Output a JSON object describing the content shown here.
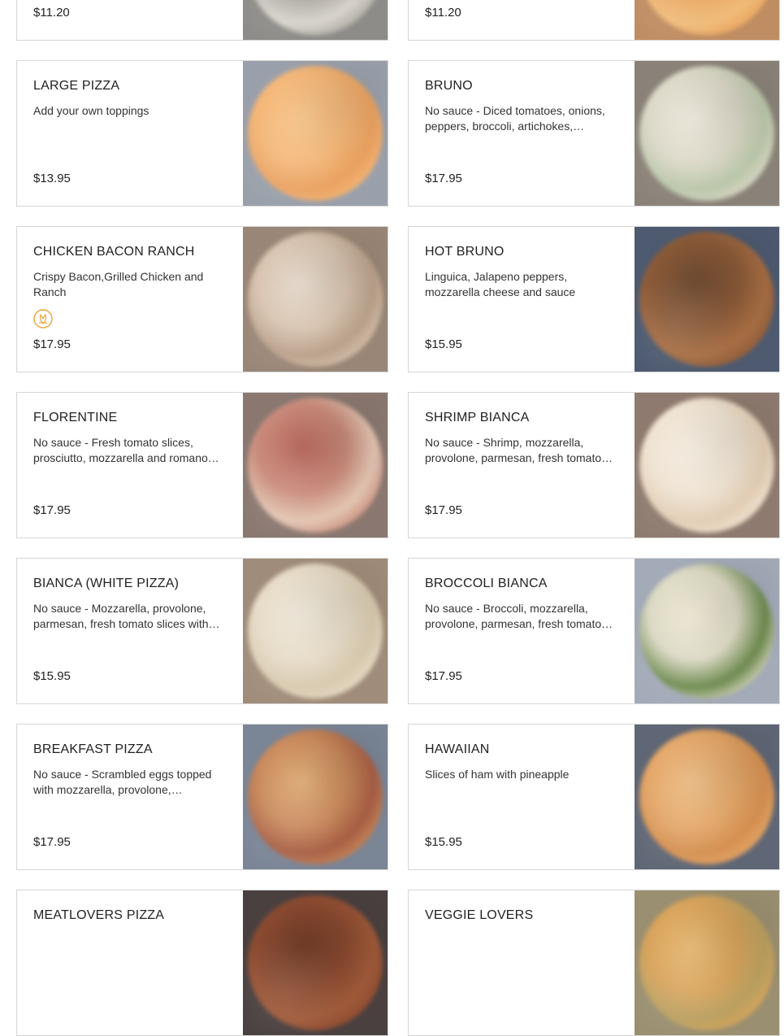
{
  "menu": {
    "items": [
      {
        "name": "",
        "description": "",
        "price": "$11.20",
        "photo_colors": [
          "#a7a39c",
          "#d9d5cd",
          "#8f8a82"
        ],
        "bg": "#8e8c88"
      },
      {
        "name": "",
        "description": "",
        "price": "$11.20",
        "photo_colors": [
          "#e8a45c",
          "#f0bc7a",
          "#d98b45"
        ],
        "bg": "#c08d62"
      },
      {
        "name": "LARGE PIZZA",
        "description": "Add your own toppings",
        "price": "$13.95",
        "photo_colors": [
          "#f4b778",
          "#eaa160",
          "#f8c890"
        ],
        "bg": "#9aa0ab"
      },
      {
        "name": "BRUNO",
        "description": "No sauce - Diced tomatoes, onions, peppers, broccoli, artichokes, mushrooms, spinach, mozzarella",
        "price": "$17.95",
        "photo_colors": [
          "#dcd8c8",
          "#b9c6a8",
          "#eee9dc"
        ],
        "bg": "#8a8278"
      },
      {
        "name": "CHICKEN BACON RANCH",
        "description": "Crispy Bacon,Grilled Chicken and Ranch",
        "price": "$17.95",
        "badge": "spicy-pepper-icon",
        "photo_colors": [
          "#d8c4b0",
          "#b9a08a",
          "#e8dccf"
        ],
        "bg": "#9a8676"
      },
      {
        "name": "HOT BRUNO",
        "description": "Linguica, Jalapeno peppers, mozzarella cheese and sauce",
        "price": "$15.95",
        "photo_colors": [
          "#8a5a38",
          "#a86e44",
          "#6e4a30"
        ],
        "bg": "#4d5a70"
      },
      {
        "name": "FLORENTINE",
        "description": "No sauce - Fresh tomato slices, prosciutto, mozzarella and romano cheese with fresh garlic",
        "price": "$17.95",
        "photo_colors": [
          "#c98a7a",
          "#e3c6b3",
          "#b8685e"
        ],
        "bg": "#8a7870"
      },
      {
        "name": "SHRIMP BIANCA",
        "description": "No sauce - Shrimp, mozzarella, provolone, parmesan, fresh tomato slices with garlic",
        "price": "$17.95",
        "photo_colors": [
          "#efe3d2",
          "#e2cdb4",
          "#f6eee2"
        ],
        "bg": "#8e7a6e"
      },
      {
        "name": "BIANCA (WHITE PIZZA)",
        "description": "No sauce - Mozzarella, provolone, parmesan, fresh tomato slices with garlic",
        "price": "$15.95",
        "photo_colors": [
          "#e7dcc8",
          "#d8c9ae",
          "#efe8da"
        ],
        "bg": "#a08c7a"
      },
      {
        "name": "BROCCOLI BIANCA",
        "description": "No sauce - Broccoli, mozzarella, provolone, parmesan, fresh tomato slices with garlic",
        "price": "$17.95",
        "photo_colors": [
          "#dcd9c4",
          "#6d8a4e",
          "#f0ead6"
        ],
        "bg": "#a3aab8"
      },
      {
        "name": "BREAKFAST PIZZA",
        "description": "No sauce - Scrambled eggs topped with mozzarella, provolone, parmesan, bacon and sausage",
        "price": "$17.95",
        "photo_colors": [
          "#c98a5c",
          "#a85e44",
          "#e2b07c"
        ],
        "bg": "#7a8596"
      },
      {
        "name": "HAWAIIAN",
        "description": "Slices of ham with pineapple",
        "price": "$15.95",
        "photo_colors": [
          "#e4a86a",
          "#d58f50",
          "#eec08a"
        ],
        "bg": "#5f6675"
      },
      {
        "name": "MEATLOVERS PIZZA",
        "description": "",
        "price": "",
        "photo_colors": [
          "#8a4a30",
          "#a05a3a",
          "#6e3a26"
        ],
        "bg": "#4a4040"
      },
      {
        "name": "VEGGIE LOVERS",
        "description": "",
        "price": "",
        "photo_colors": [
          "#d9a45c",
          "#b9a060",
          "#e8bc78"
        ],
        "bg": "#9a8f70"
      }
    ]
  },
  "colors": {
    "border": "#d6d6d6",
    "text": "#222222",
    "badge": "#e8a33c"
  }
}
